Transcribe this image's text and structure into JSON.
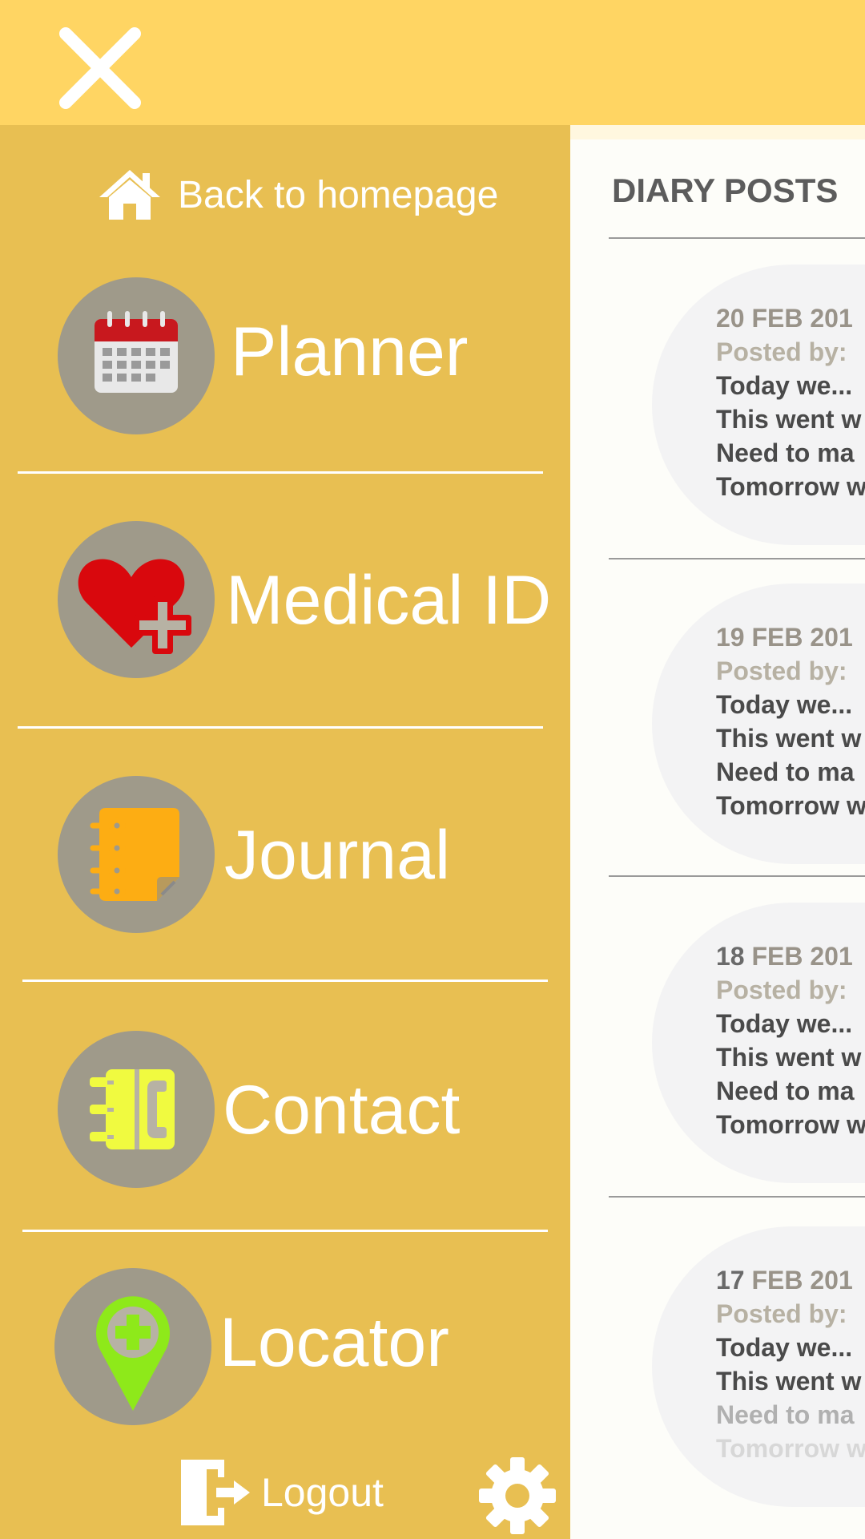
{
  "header": {
    "close_icon": "close-icon"
  },
  "drawer": {
    "home_link": {
      "label": "Back to homepage",
      "icon": "home-icon"
    },
    "items": [
      {
        "label": "Planner",
        "icon": "calendar-icon"
      },
      {
        "label": "Medical ID",
        "icon": "medical-heart-icon"
      },
      {
        "label": "Journal",
        "icon": "notebook-icon"
      },
      {
        "label": "Contact",
        "icon": "contact-book-icon"
      },
      {
        "label": "Locator",
        "icon": "map-pin-plus-icon"
      }
    ],
    "logout": {
      "label": "Logout",
      "icon": "logout-icon"
    },
    "settings": {
      "icon": "gear-icon"
    }
  },
  "content": {
    "title": "DIARY POSTS",
    "posts": [
      {
        "day": "20",
        "date": "20 FEB 201",
        "posted_by": "Posted by:",
        "lines": [
          "Today we...",
          "This went w",
          "Need to ma",
          "Tomorrow w"
        ]
      },
      {
        "day": "19",
        "date": "19 FEB 201",
        "posted_by": "Posted by:",
        "lines": [
          "Today we...",
          "This went w",
          "Need to ma",
          "Tomorrow w"
        ]
      },
      {
        "day": "18",
        "month": "FEB 201",
        "posted_by": "Posted by:",
        "lines": [
          "Today we...",
          "This went w",
          "Need to ma",
          "Tomorrow w"
        ]
      },
      {
        "day": "17",
        "month": "FEB 201",
        "posted_by": "Posted by:",
        "lines": [
          "Today we...",
          "This went w",
          "Need to ma",
          "Tomorrow w"
        ]
      }
    ]
  },
  "colors": {
    "topbar": "#ffd563",
    "drawer": "#e8bf52",
    "menu_circle": "#9f9a8a",
    "content_bg": "#fdfdf9"
  }
}
